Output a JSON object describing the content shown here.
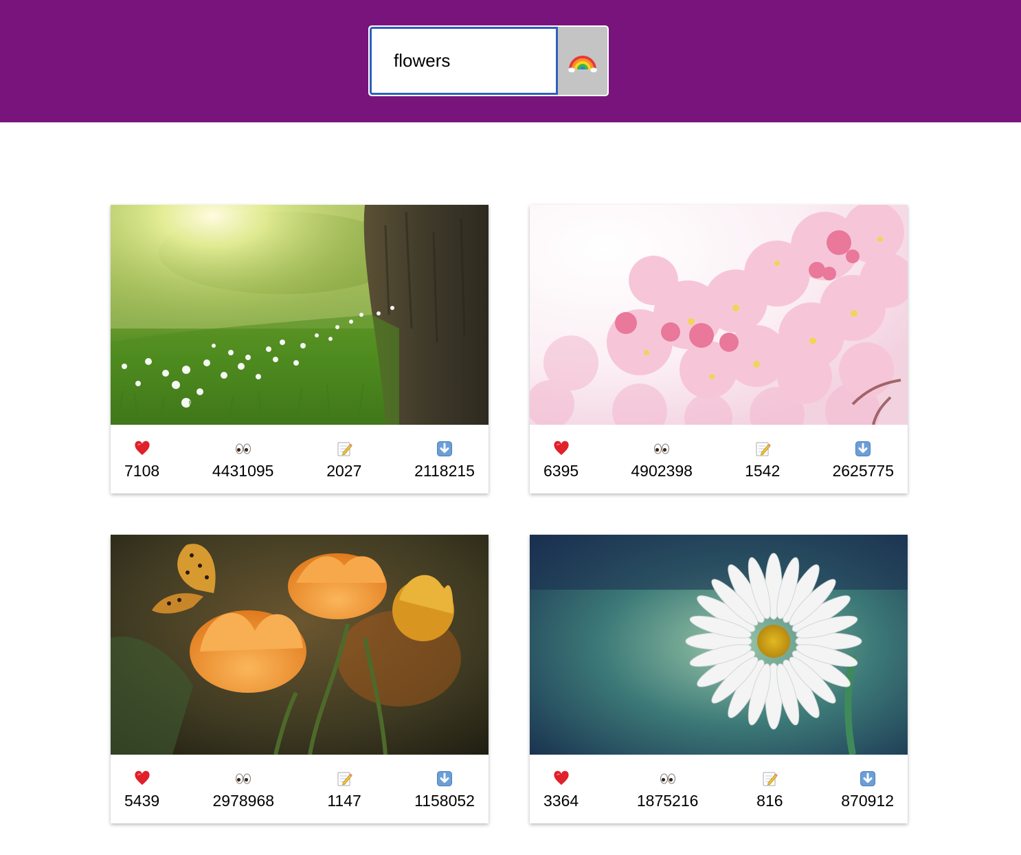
{
  "search": {
    "value": "flowers",
    "button_icon": "rainbow-icon"
  },
  "colors": {
    "header": "#78147c",
    "input_border": "#2f5fbf",
    "button": "#c4c4c4"
  },
  "stat_icons": [
    "heart-icon",
    "eyes-icon",
    "memo-icon",
    "down-arrow-icon"
  ],
  "cards": [
    {
      "image": "meadow-with-white-flowers-and-tree",
      "likes": "7108",
      "views": "4431095",
      "comments": "2027",
      "downloads": "2118215"
    },
    {
      "image": "pink-cherry-blossoms",
      "likes": "6395",
      "views": "4902398",
      "comments": "1542",
      "downloads": "2625775"
    },
    {
      "image": "orange-flowers-with-butterfly",
      "likes": "5439",
      "views": "2978968",
      "comments": "1147",
      "downloads": "1158052"
    },
    {
      "image": "white-daisy-on-teal-background",
      "likes": "3364",
      "views": "1875216",
      "comments": "816",
      "downloads": "870912"
    }
  ]
}
